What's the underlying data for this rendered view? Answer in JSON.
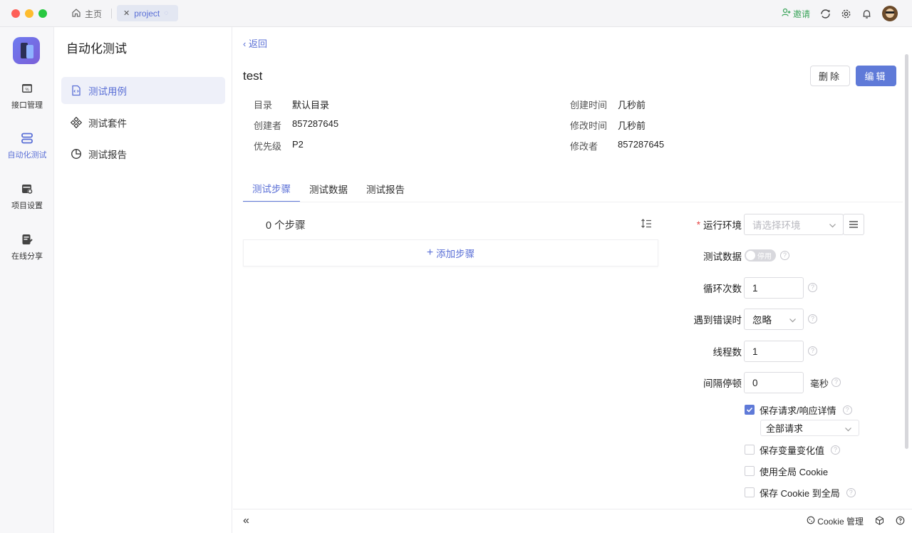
{
  "titlebar": {
    "home_tab": "主页",
    "project_tab": "project",
    "invite": "邀请"
  },
  "rail": {
    "items": [
      {
        "label": "接口管理",
        "icon": "api-icon"
      },
      {
        "label": "自动化测试",
        "icon": "automation-icon",
        "active": true
      },
      {
        "label": "项目设置",
        "icon": "settings-icon"
      },
      {
        "label": "在线分享",
        "icon": "share-icon"
      }
    ]
  },
  "subnav": {
    "title": "自动化测试",
    "items": [
      {
        "label": "测试用例",
        "icon": "testcase-icon",
        "active": true
      },
      {
        "label": "测试套件",
        "icon": "suite-icon"
      },
      {
        "label": "测试报告",
        "icon": "report-icon"
      }
    ]
  },
  "main": {
    "back": "返回",
    "title": "test",
    "delete_btn": "删除",
    "edit_btn": "编辑",
    "meta": {
      "dir_label": "目录",
      "dir_value": "默认目录",
      "creator_label": "创建者",
      "creator_value": "857287645",
      "priority_label": "优先级",
      "priority_value": "P2",
      "created_label": "创建时间",
      "created_value": "几秒前",
      "modified_label": "修改时间",
      "modified_value": "几秒前",
      "modifier_label": "修改者",
      "modifier_value": "857287645"
    },
    "tabs": [
      "测试步骤",
      "测试数据",
      "测试报告"
    ],
    "active_tab": 0,
    "steps_count": "0 个步骤",
    "add_step": "添加步骤"
  },
  "form": {
    "env_label": "运行环境",
    "env_placeholder": "请选择环境",
    "data_label": "测试数据",
    "data_switch": "停用",
    "loop_label": "循环次数",
    "loop_value": "1",
    "error_label": "遇到错误时",
    "error_value": "忽略",
    "threads_label": "线程数",
    "threads_value": "1",
    "interval_label": "间隔停顿",
    "interval_value": "0",
    "interval_unit": "毫秒",
    "save_req_label": "保存请求/响应详情",
    "save_req_checked": true,
    "save_req_scope": "全部请求",
    "save_var_label": "保存变量变化值",
    "save_var_checked": false,
    "global_cookie_label": "使用全局 Cookie",
    "global_cookie_checked": false,
    "save_cookie_label": "保存 Cookie 到全局",
    "save_cookie_checked": false
  },
  "statusbar": {
    "cookie": "Cookie 管理"
  },
  "colors": {
    "accent": "#5f7ad8",
    "accent_text": "#5a6fd6",
    "invite": "#3aa45a",
    "required": "#e54545"
  }
}
